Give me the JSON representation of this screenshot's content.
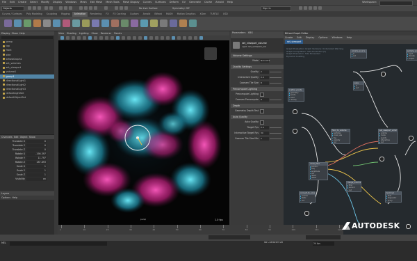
{
  "menubar": {
    "items": [
      "File",
      "Edit",
      "Create",
      "Select",
      "Modify",
      "Display",
      "Windows",
      "Mesh",
      "Edit Mesh",
      "Mesh Tools",
      "Mesh Display",
      "Curves",
      "Surfaces",
      "Deform",
      "UV",
      "Generate",
      "Cache",
      "Arnold",
      "Help"
    ],
    "workspace_label": "Workspace:"
  },
  "statusline": {
    "mode": "Objects",
    "live_surface": "No Live Surface",
    "symmetry": "Symmetry: Off",
    "sign_in": "Sign In"
  },
  "shelf": {
    "tabs": [
      "Curves / Surfaces",
      "Poly Modeling",
      "Sculpting",
      "Rigging",
      "Animation",
      "Rendering",
      "FX",
      "FX Caching",
      "Custom",
      "Arnold",
      "Bifrost",
      "MASH",
      "Motion Graphics",
      "XGen",
      "TURTLE",
      "USD"
    ],
    "active_index": 4
  },
  "outliner": {
    "menu": [
      "Display",
      "Show",
      "Help"
    ],
    "items": [
      {
        "label": "persp",
        "selected": false
      },
      {
        "label": "top",
        "selected": false
      },
      {
        "label": "front",
        "selected": false
      },
      {
        "label": "side",
        "selected": false
      },
      {
        "label": "bifrostGraph1",
        "selected": false
      },
      {
        "label": "set_volumes",
        "selected": false
      },
      {
        "label": "set_viewport",
        "selected": false
      },
      {
        "label": "volume1",
        "selected": false
      },
      {
        "label": "group1",
        "selected": true
      },
      {
        "label": "directionalLight1",
        "selected": false
      },
      {
        "label": "directionalLight2",
        "selected": false
      },
      {
        "label": "directionalLight3",
        "selected": false
      },
      {
        "label": "defaultLightSet",
        "selected": false
      },
      {
        "label": "defaultObjectSet",
        "selected": false
      }
    ]
  },
  "channel_box": {
    "menu": [
      "Channels",
      "Edit",
      "Object",
      "Show"
    ],
    "rows": [
      {
        "label": "Translate X",
        "value": "0"
      },
      {
        "label": "Translate Y",
        "value": "0"
      },
      {
        "label": "Translate Z",
        "value": "0"
      },
      {
        "label": "Rotate X",
        "value": "-190.397"
      },
      {
        "label": "Rotate Y",
        "value": "11.797"
      },
      {
        "label": "Rotate Z",
        "value": "187.893"
      },
      {
        "label": "Scale X",
        "value": "1"
      },
      {
        "label": "Scale Y",
        "value": "1"
      },
      {
        "label": "Scale Z",
        "value": "1"
      },
      {
        "label": "Visibility",
        "value": "on"
      }
    ]
  },
  "layers": {
    "title": "Layers",
    "menu": [
      "Options",
      "Help"
    ]
  },
  "viewport": {
    "menu": [
      "View",
      "Shading",
      "Lighting",
      "Show",
      "Renderer",
      "Panels"
    ],
    "camera_label": "persp",
    "fps": "1.0 fps"
  },
  "attribute_editor": {
    "tabs": [
      "Parameters",
      "XBG"
    ],
    "node_name": "set_viewport_volume",
    "node_type": "Type: set_viewport_vol",
    "sections": [
      {
        "title": "Volume Settings",
        "rows": [
          {
            "label": "Mode",
            "value": "NanoVTT"
          }
        ]
      },
      {
        "title": "Quality Settings",
        "rows": [
          {
            "label": "Quality",
            "value": "2"
          },
          {
            "label": "Interactive Quality",
            "value": "0.4"
          },
          {
            "label": "Coarsen Tile Size",
            "value": "8"
          }
        ]
      },
      {
        "title": "Precompute Lighting",
        "rows": [
          {
            "label": "Precompute Lighting",
            "value": "on"
          },
          {
            "label": "Coarsen Precompute",
            "value": "8"
          }
        ]
      },
      {
        "title": "Depth",
        "rows": [
          {
            "label": "Geometry Depth Test",
            "value": "on"
          }
        ]
      },
      {
        "title": "Auto Quality",
        "rows": [
          {
            "label": "Auto Quality",
            "value": "on"
          },
          {
            "label": "Target Fps",
            "value": "0.4"
          },
          {
            "label": "Interactive Target Fps",
            "value": "30"
          },
          {
            "label": "Coarsen Tile Size Min",
            "value": "2"
          }
        ]
      }
    ]
  },
  "graph_editor": {
    "title": "Bifrost Graph Editor",
    "menu": [
      "Create",
      "Edit",
      "Display",
      "Options",
      "Windows",
      "Help"
    ],
    "tab": "set_viewport",
    "info": [
      "Graph Evaluation Graph Variance: Undersized Warning",
      "Graph Compilation: Size Exceeded (1)",
      "Graph Execution: Size Exceeded",
      "Dynamic Loading"
    ],
    "nodes": [
      {
        "title": "scatter_points",
        "rows": [
          "geometry",
          "points",
          "seed",
          "density"
        ]
      },
      {
        "title": "volume_source",
        "rows": [
          "in",
          "out"
        ]
      },
      {
        "title": "pass",
        "rows": [
          "in",
          "out"
        ]
      },
      {
        "title": "fluid_to_volume",
        "rows": [
          "particles",
          "voxel_size",
          "fog",
          "velocity",
          "out"
        ]
      },
      {
        "title": "noise_field",
        "rows": [
          "position",
          "freq",
          "amplitude",
          "out",
          "result",
          "offset"
        ]
      },
      {
        "title": "convert_to_volume",
        "rows": [
          "volume",
          "fields",
          "out"
        ]
      },
      {
        "title": "set_viewport_volume",
        "rows": [
          "volume",
          "mode",
          "quality",
          "interactive",
          "out"
        ]
      },
      {
        "title": "merge_volumes",
        "rows": [
          "first",
          "second",
          "out"
        ]
      },
      {
        "title": "terminal",
        "rows": [
          "final",
          "diagnostic",
          "proxy"
        ]
      },
      {
        "title": "sample_volume",
        "rows": [
          "input",
          "density",
          "output"
        ]
      }
    ]
  },
  "timeline": {
    "ticks": [
      "1",
      "10",
      "20",
      "30",
      "40",
      "50",
      "60",
      "70",
      "80",
      "90",
      "100",
      "110",
      "120"
    ]
  },
  "brand": {
    "text": "AUTODESK"
  },
  "commandline": {
    "lang": "MEL",
    "no_char_set": "No Character Set",
    "fps": "24 fps"
  },
  "colors": {
    "accent": "#5285a6",
    "volume_pink": "#e0309a",
    "volume_cyan": "#2ab5c6"
  }
}
